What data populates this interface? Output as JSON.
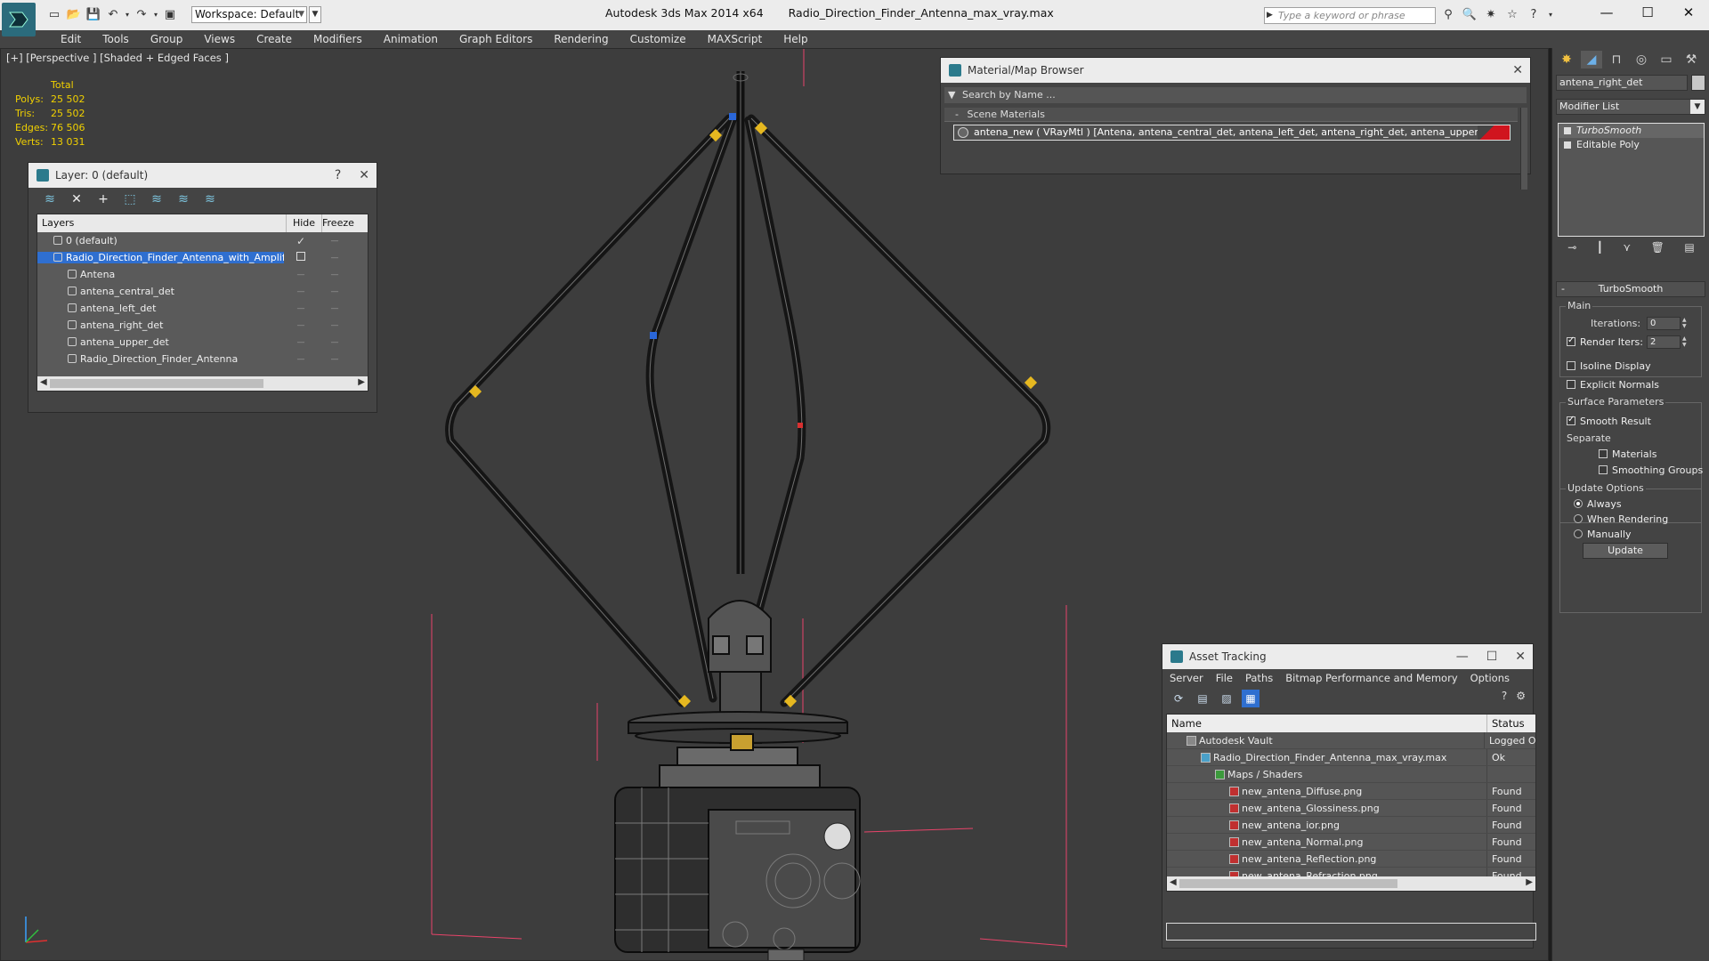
{
  "titlebar": {
    "app_name": "Autodesk 3ds Max  2014 x64",
    "file_name": "Radio_Direction_Finder_Antenna_max_vray.max",
    "workspace": "Workspace: Default",
    "search_placeholder": "Type a keyword or phrase"
  },
  "menu": [
    "Edit",
    "Tools",
    "Group",
    "Views",
    "Create",
    "Modifiers",
    "Animation",
    "Graph Editors",
    "Rendering",
    "Customize",
    "MAXScript",
    "Help"
  ],
  "viewport": {
    "label": "[+] [Perspective ] [Shaded + Edged Faces ]",
    "stats_header": "Total",
    "stats": [
      {
        "key": "Polys:",
        "value": "25 502"
      },
      {
        "key": "Tris:",
        "value": "25 502"
      },
      {
        "key": "Edges:",
        "value": "76 506"
      },
      {
        "key": "Verts:",
        "value": "13 031"
      }
    ],
    "stats_color": "#f0d000"
  },
  "layer_panel": {
    "title": "Layer: 0 (default)",
    "help": "?",
    "close": "✕",
    "col_layers": "Layers",
    "col_hide": "Hide",
    "col_freeze": "Freeze",
    "rows": [
      {
        "name": "0 (default)",
        "indent": 1,
        "check": "✓"
      },
      {
        "name": "Radio_Direction_Finder_Antenna_with_Amplifier",
        "indent": 1,
        "selected": true
      },
      {
        "name": "Antena",
        "indent": 2
      },
      {
        "name": "antena_central_det",
        "indent": 2
      },
      {
        "name": "antena_left_det",
        "indent": 2
      },
      {
        "name": "antena_right_det",
        "indent": 2
      },
      {
        "name": "antena_upper_det",
        "indent": 2
      },
      {
        "name": "Radio_Direction_Finder_Antenna",
        "indent": 2
      }
    ],
    "hide_marker": "—",
    "freeze_marker": "—"
  },
  "material_browser": {
    "title": "Material/Map Browser",
    "search_placeholder": "Search by Name ...",
    "group": "Scene Materials",
    "group_toggle": "-",
    "item": "antena_new  ( VRayMtl )  [Antena, antena_central_det, antena_left_det, antena_right_det, antena_upper_det]",
    "swatch_color": "#d0141e"
  },
  "command_panel": {
    "object_name": "antena_right_det",
    "modifier_list": "Modifier List",
    "stack": [
      "TurboSmooth",
      "Editable Poly"
    ],
    "rollout_title": "TurboSmooth",
    "rollout_toggle": "-",
    "main_label": "Main",
    "iterations_label": "Iterations:",
    "iterations_value": "0",
    "render_iters_label": "Render Iters:",
    "render_iters_value": "2",
    "isoline_display": "Isoline Display",
    "explicit_normals": "Explicit Normals",
    "surface_params": "Surface Parameters",
    "smooth_result": "Smooth Result",
    "separate": "Separate",
    "materials": "Materials",
    "smoothing_groups": "Smoothing Groups",
    "update_options": "Update Options",
    "always": "Always",
    "when_rendering": "When Rendering",
    "manually": "Manually",
    "update_button": "Update"
  },
  "asset_tracking": {
    "title": "Asset Tracking",
    "menu": [
      "Server",
      "File",
      "Paths",
      "Bitmap Performance and Memory",
      "Options"
    ],
    "col_name": "Name",
    "col_status": "Status",
    "rows": [
      {
        "name": "Autodesk Vault",
        "status": "Logged O",
        "indent": 1,
        "icon": "vault"
      },
      {
        "name": "Radio_Direction_Finder_Antenna_max_vray.max",
        "status": "Ok",
        "indent": 2,
        "icon": "file"
      },
      {
        "name": "Maps / Shaders",
        "status": "",
        "indent": 3,
        "icon": "maps"
      },
      {
        "name": "new_antena_Diffuse.png",
        "status": "Found",
        "indent": 4,
        "icon": "png"
      },
      {
        "name": "new_antena_Glossiness.png",
        "status": "Found",
        "indent": 4,
        "icon": "png"
      },
      {
        "name": "new_antena_ior.png",
        "status": "Found",
        "indent": 4,
        "icon": "png"
      },
      {
        "name": "new_antena_Normal.png",
        "status": "Found",
        "indent": 4,
        "icon": "png"
      },
      {
        "name": "new_antena_Reflection.png",
        "status": "Found",
        "indent": 4,
        "icon": "png"
      },
      {
        "name": "new_antena_Refraction.png",
        "status": "Found",
        "indent": 4,
        "icon": "png"
      }
    ]
  },
  "colors": {
    "accent_selected": "#2f6fd0",
    "viewport_bg": "#3d3d3d",
    "panel_bg": "#444444"
  }
}
